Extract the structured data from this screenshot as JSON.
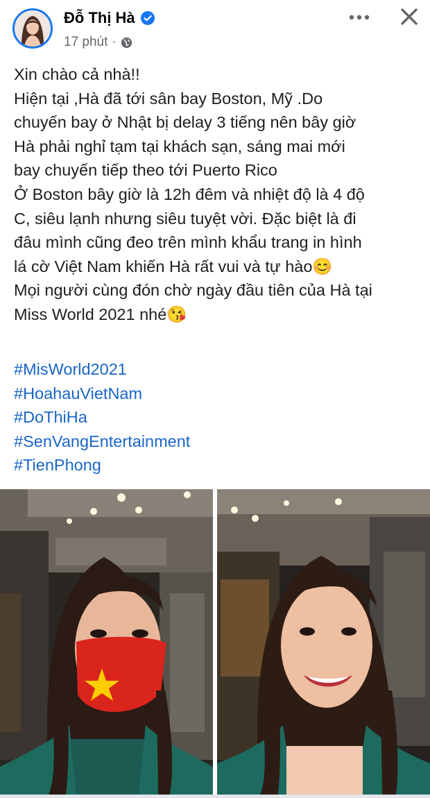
{
  "post": {
    "author": "Đỗ Thị Hà",
    "time": "17 phút",
    "separator": "·",
    "privacy_icon": "globe-icon",
    "verified_icon": "verified-badge-icon",
    "text_lines": [
      "Xin chào cả nhà!!",
      "Hiện tại ,Hà đã tới sân bay Boston, Mỹ .Do",
      "chuyến bay ở Nhật bị delay 3 tiếng nên bây giờ",
      "Hà phải nghỉ tạm tại khách sạn, sáng mai mới",
      "bay chuyến tiếp theo tới Puerto Rico",
      "Ở Boston bây giờ là 12h đêm và nhiệt độ là 4 độ",
      "C, siêu lạnh nhưng siêu tuyệt vời. Đặc biệt là đi",
      "đâu mình cũng đeo trên mình khẩu trang in hình",
      "lá cờ Việt Nam  khiến Hà rất vui và tự hào😊",
      "Mọi người cùng đón chờ ngày đầu tiên của Hà tại",
      "Miss World 2021 nhé😘"
    ],
    "hashtags": [
      "#MisWorld2021",
      "#HoahauVietNam",
      "#DoThiHa",
      "#SenVangEntertainment",
      "#TienPhong"
    ]
  },
  "toolbar": {
    "more_icon": "more-options-icon",
    "close_icon": "close-icon"
  },
  "colors": {
    "accent": "#1877f2",
    "hashtag": "#1966c6",
    "meta": "#65676b",
    "flag_red": "#da251d",
    "flag_star": "#ffcd00"
  }
}
